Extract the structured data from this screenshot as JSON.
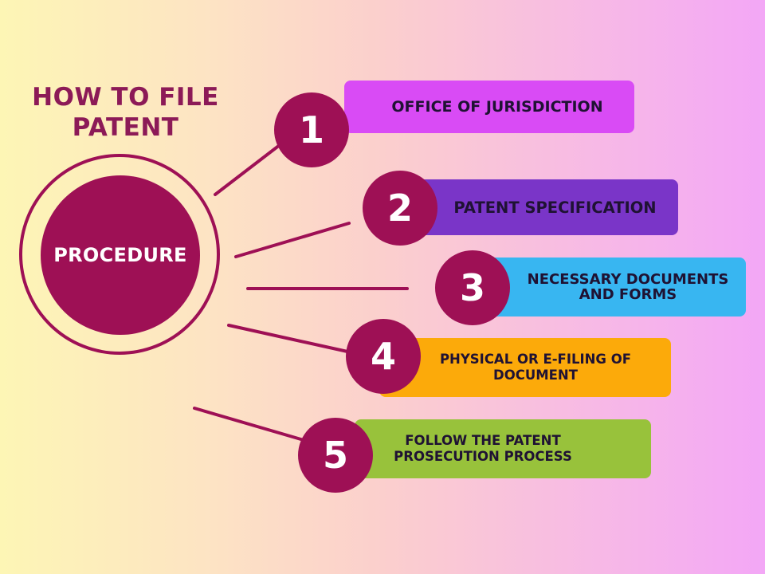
{
  "title": "HOW TO FILE PATENT",
  "center_label": "PROCEDURE",
  "colors": {
    "accent": "#9e1055",
    "step1": "#d94bf5",
    "step2": "#7a35c8",
    "step3": "#38b6f1",
    "step4": "#fcaa0a",
    "step5": "#98c23b"
  },
  "steps": [
    {
      "number": "1",
      "label": "OFFICE OF JURISDICTION"
    },
    {
      "number": "2",
      "label": "PATENT SPECIFICATION"
    },
    {
      "number": "3",
      "label": "NECESSARY DOCUMENTS AND FORMS"
    },
    {
      "number": "4",
      "label": "PHYSICAL OR E-FILING OF DOCUMENT"
    },
    {
      "number": "5",
      "label": "FOLLOW THE PATENT PROSECUTION PROCESS"
    }
  ]
}
